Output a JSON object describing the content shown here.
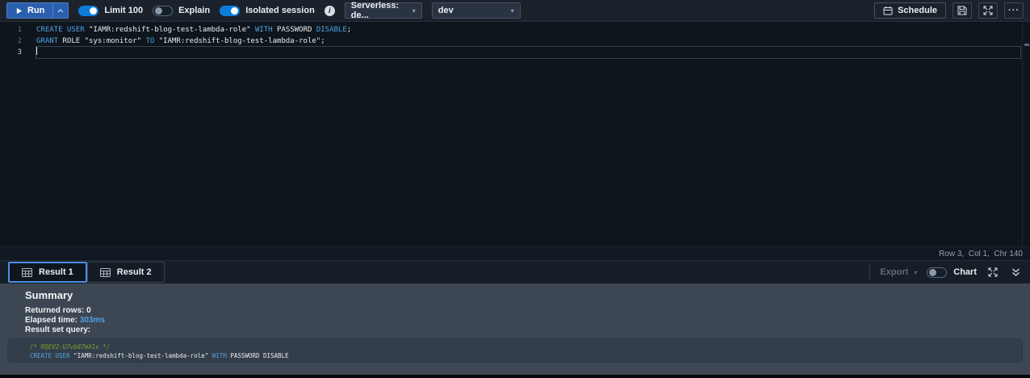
{
  "toolbar": {
    "run_label": "Run",
    "limit_label": "Limit 100",
    "explain_label": "Explain",
    "isolated_label": "Isolated session",
    "workgroup_value": "Serverless: de...",
    "database_value": "dev",
    "schedule_label": "Schedule",
    "limit_on": true,
    "explain_on": false,
    "isolated_on": true
  },
  "icons": {
    "dropdown_caret": "▾",
    "more": "···",
    "info": "i"
  },
  "editor": {
    "status": "Row 3,  Col 1,  Chr 140",
    "lines": [
      {
        "n": "1",
        "current": false,
        "tokens": [
          [
            "kw",
            "CREATE"
          ],
          [
            "pl",
            " "
          ],
          [
            "kw",
            "USER"
          ],
          [
            "pl",
            " \"IAMR:redshift-blog-test-lambda-role\" "
          ],
          [
            "kw",
            "WITH"
          ],
          [
            "pl",
            " PASSWORD "
          ],
          [
            "kw",
            "DISABLE"
          ],
          [
            "pl",
            ";"
          ]
        ]
      },
      {
        "n": "2",
        "current": false,
        "tokens": [
          [
            "kw",
            "GRANT"
          ],
          [
            "pl",
            " ROLE \"sys:monitor\" "
          ],
          [
            "kw",
            "TO"
          ],
          [
            "pl",
            " \"IAMR:redshift-blog-test-lambda-role\";"
          ]
        ]
      },
      {
        "n": "3",
        "current": true,
        "tokens": []
      }
    ]
  },
  "results": {
    "tabs": [
      {
        "label": "Result 1",
        "active": true
      },
      {
        "label": "Result 2",
        "active": false
      }
    ],
    "export_label": "Export",
    "chart_label": "Chart",
    "chart_on": false
  },
  "summary": {
    "title": "Summary",
    "returned_rows_label": "Returned rows:",
    "returned_rows_value": "0",
    "elapsed_label": "Elapsed time:",
    "elapsed_value": "303ms",
    "result_set_label": "Result set query:"
  },
  "result_query": {
    "lines": [
      {
        "tokens": [
          [
            "cm",
            "/* RQEV2-U7vb87mX1v */"
          ]
        ]
      },
      {
        "tokens": [
          [
            "kw",
            "CREATE"
          ],
          [
            "pl",
            " "
          ],
          [
            "kw",
            "USER"
          ],
          [
            "pl",
            " \"IAMR:redshift-blog-test-lambda-role\" "
          ],
          [
            "kw",
            "WITH"
          ],
          [
            "pl",
            " PASSWORD DISABLE"
          ]
        ]
      }
    ]
  },
  "colors": {
    "keyword_blue": "#4da3e0",
    "comment_green": "#7ba32f",
    "accent_blue": "#539fe5",
    "toggle_on_blue": "#0b7dd9",
    "run_button_blue": "#2a5fae",
    "tab_active_border": "#4a8fe2",
    "panel_slate": "#3d4754",
    "editor_bg": "#0f151d"
  }
}
